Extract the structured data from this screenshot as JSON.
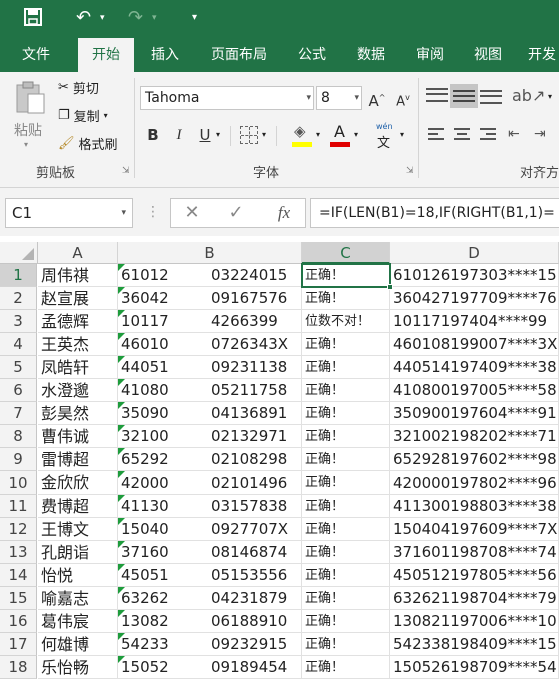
{
  "quick_access": {
    "save_icon": "save-icon",
    "undo_icon": "undo-icon",
    "redo_icon": "redo-icon",
    "customize_icon": "customize-icon"
  },
  "tabs": [
    "文件",
    "开始",
    "插入",
    "页面布局",
    "公式",
    "数据",
    "审阅",
    "视图",
    "开发"
  ],
  "active_tab": "开始",
  "clipboard": {
    "paste": "粘贴",
    "cut": "剪切",
    "copy": "复制",
    "format_painter": "格式刷",
    "group_label": "剪贴板"
  },
  "font": {
    "name": "Tahoma",
    "size": "8",
    "group_label": "字体",
    "bold": "B",
    "italic": "I",
    "underline": "U",
    "grow": "A",
    "shrink": "A",
    "color_letter": "A",
    "wen_top": "wén",
    "wen_bottom": "文"
  },
  "align": {
    "group_label": "对齐方"
  },
  "name_box": "C1",
  "formula": "=IF(LEN(B1)=18,IF(RIGHT(B1,1)=",
  "fx": "fx",
  "columns": [
    "A",
    "B",
    "C",
    "D"
  ],
  "selected_column": "C",
  "rows": [
    {
      "n": "1",
      "a": "周伟祺",
      "b1": "61012",
      "b2": "03224015",
      "c": "正确！",
      "d": "610126197303****15"
    },
    {
      "n": "2",
      "a": "赵宣展",
      "b1": "36042",
      "b2": "09167576",
      "c": "正确！",
      "d": "360427197709****76"
    },
    {
      "n": "3",
      "a": "孟德辉",
      "b1": "10117",
      "b2": "4266399",
      "c": "位数不对！",
      "d": "10117197404****99"
    },
    {
      "n": "4",
      "a": "王英杰",
      "b1": "46010",
      "b2": "0726343X",
      "c": "正确！",
      "d": "460108199007****3X"
    },
    {
      "n": "5",
      "a": "凤皓轩",
      "b1": "44051",
      "b2": "09231138",
      "c": "正确！",
      "d": "440514197409****38"
    },
    {
      "n": "6",
      "a": "水澄邈",
      "b1": "41080",
      "b2": "05211758",
      "c": "正确！",
      "d": "410800197005****58"
    },
    {
      "n": "7",
      "a": "彭昊然",
      "b1": "35090",
      "b2": "04136891",
      "c": "正确！",
      "d": "350900197604****91"
    },
    {
      "n": "8",
      "a": "曹伟诚",
      "b1": "32100",
      "b2": "02132971",
      "c": "正确！",
      "d": "321002198202****71"
    },
    {
      "n": "9",
      "a": "雷博超",
      "b1": "65292",
      "b2": "02108298",
      "c": "正确！",
      "d": "652928197602****98"
    },
    {
      "n": "10",
      "a": "金欣欣",
      "b1": "42000",
      "b2": "02101496",
      "c": "正确！",
      "d": "420000197802****96"
    },
    {
      "n": "11",
      "a": "费博超",
      "b1": "41130",
      "b2": "03157838",
      "c": "正确！",
      "d": "411300198803****38"
    },
    {
      "n": "12",
      "a": "王博文",
      "b1": "15040",
      "b2": "0927707X",
      "c": "正确！",
      "d": "150404197609****7X"
    },
    {
      "n": "13",
      "a": "孔朗诣",
      "b1": "37160",
      "b2": "08146874",
      "c": "正确！",
      "d": "371601198708****74"
    },
    {
      "n": "14",
      "a": "怡悦",
      "b1": "45051",
      "b2": "05153556",
      "c": "正确！",
      "d": "450512197805****56"
    },
    {
      "n": "15",
      "a": "喻嘉志",
      "b1": "63262",
      "b2": "04231879",
      "c": "正确！",
      "d": "632621198704****79"
    },
    {
      "n": "16",
      "a": "葛伟宸",
      "b1": "13082",
      "b2": "06188910",
      "c": "正确！",
      "d": "130821197006****10"
    },
    {
      "n": "17",
      "a": "何雄博",
      "b1": "54233",
      "b2": "09232915",
      "c": "正确！",
      "d": "542338198409****15"
    },
    {
      "n": "18",
      "a": "乐怡畅",
      "b1": "15052",
      "b2": "09189454",
      "c": "正确！",
      "d": "150526198709****54"
    }
  ]
}
